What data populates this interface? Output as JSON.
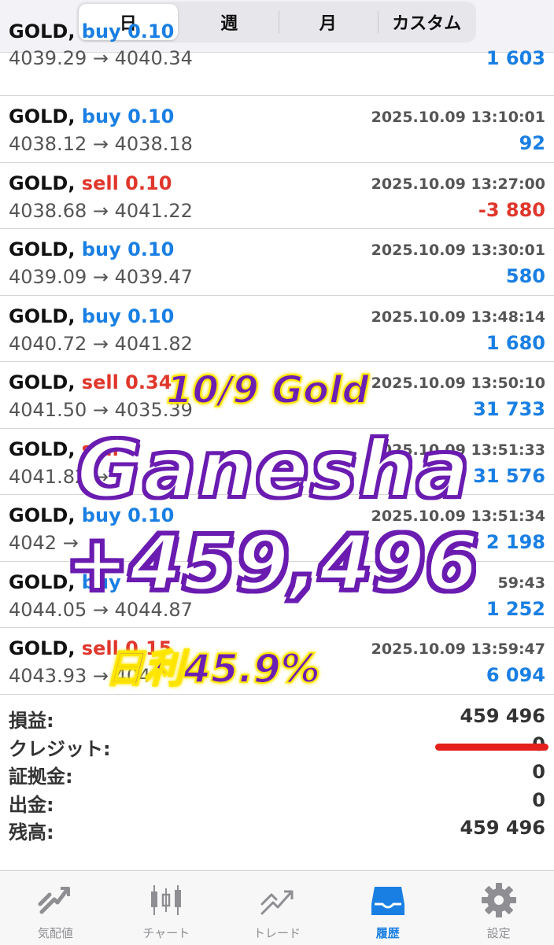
{
  "period_tabs": [
    {
      "label": "日",
      "active": true
    },
    {
      "label": "週",
      "active": false
    },
    {
      "label": "月",
      "active": false
    },
    {
      "label": "カスタム",
      "active": false
    }
  ],
  "trades": [
    {
      "symbol": "GOLD,",
      "type": "buy",
      "volume": "0.10",
      "time": "",
      "open": "4039.29",
      "close": "4040.34",
      "profit": "1 603",
      "profit_sign": "pos"
    },
    {
      "symbol": "GOLD,",
      "type": "buy",
      "volume": "0.10",
      "time": "2025.10.09 13:10:01",
      "open": "4038.12",
      "close": "4038.18",
      "profit": "92",
      "profit_sign": "pos"
    },
    {
      "symbol": "GOLD,",
      "type": "sell",
      "volume": "0.10",
      "time": "2025.10.09 13:27:00",
      "open": "4038.68",
      "close": "4041.22",
      "profit": "-3 880",
      "profit_sign": "neg"
    },
    {
      "symbol": "GOLD,",
      "type": "buy",
      "volume": "0.10",
      "time": "2025.10.09 13:30:01",
      "open": "4039.09",
      "close": "4039.47",
      "profit": "580",
      "profit_sign": "pos"
    },
    {
      "symbol": "GOLD,",
      "type": "buy",
      "volume": "0.10",
      "time": "2025.10.09 13:48:14",
      "open": "4040.72",
      "close": "4041.82",
      "profit": "1 680",
      "profit_sign": "pos"
    },
    {
      "symbol": "GOLD,",
      "type": "sell",
      "volume": "0.34",
      "time": "2025.10.09 13:50:10",
      "open": "4041.50",
      "close": "4035.39",
      "profit": "31 733",
      "profit_sign": "pos"
    },
    {
      "symbol": "GOLD,",
      "type": "sell",
      "volume": "",
      "time": "2025.10.09 13:51:33",
      "open": "4041.82",
      "close": "",
      "profit": "31 576",
      "profit_sign": "pos"
    },
    {
      "symbol": "GOLD,",
      "type": "buy",
      "volume": "0.10",
      "time": "2025.10.09 13:51:34",
      "open": "4042",
      "close": "",
      "profit": "2 198",
      "profit_sign": "pos"
    },
    {
      "symbol": "GOLD,",
      "type": "buy",
      "volume": "",
      "time": "59:43",
      "open": "4044.05",
      "close": "4044.87",
      "profit": "1 252",
      "profit_sign": "pos"
    },
    {
      "symbol": "GOLD,",
      "type": "sell",
      "volume": "0.15",
      "time": "2025.10.09 13:59:47",
      "open": "4043.93",
      "close": "404",
      "profit": "6 094",
      "profit_sign": "pos"
    }
  ],
  "arrow": "→",
  "summary": [
    {
      "label": "損益:",
      "value": "459 496"
    },
    {
      "label": "クレジット:",
      "value": "0"
    },
    {
      "label": "証拠金:",
      "value": "0"
    },
    {
      "label": "出金:",
      "value": "0"
    },
    {
      "label": "残高:",
      "value": "459 496"
    }
  ],
  "tab_bar": [
    {
      "label": "気配値",
      "icon": "quotes-icon",
      "active": false
    },
    {
      "label": "チャート",
      "icon": "chart-icon",
      "active": false
    },
    {
      "label": "トレード",
      "icon": "trade-icon",
      "active": false
    },
    {
      "label": "履歴",
      "icon": "history-icon",
      "active": true
    },
    {
      "label": "設定",
      "icon": "settings-icon",
      "active": false
    }
  ],
  "overlay": {
    "date_line": "10/9 Gold",
    "name": "Ganesha",
    "amount": "+459,496",
    "daily_rate": "日利45.9%"
  },
  "colors": {
    "buy": "#1a7fe3",
    "sell": "#e0362b",
    "accent": "#1a7fe3",
    "overlay_purple": "#6a1bb0",
    "overlay_yellow": "#ffe600"
  }
}
